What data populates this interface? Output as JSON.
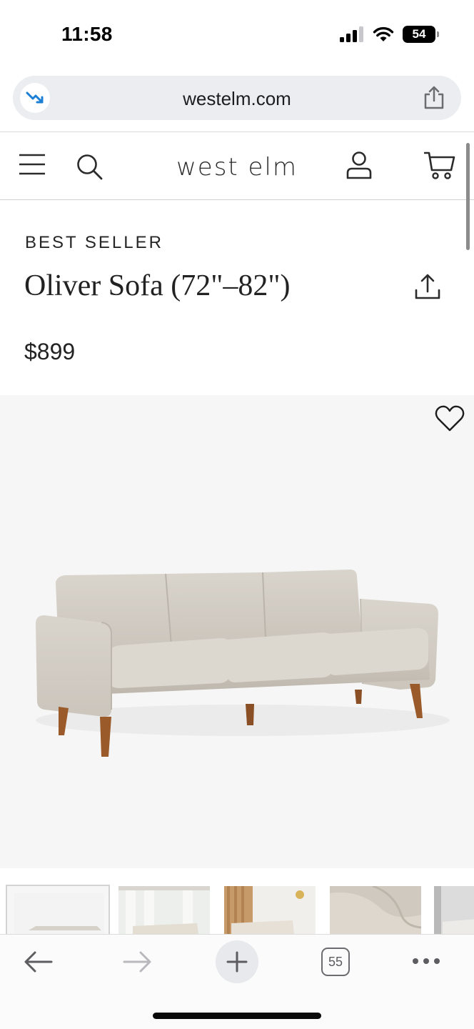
{
  "status_bar": {
    "time": "11:58",
    "battery_level": "54",
    "icons": [
      "cellular-signal-icon",
      "wifi-icon",
      "battery-icon"
    ]
  },
  "browser": {
    "url": "westelm.com",
    "open_tabs": "55",
    "icons": [
      "tracking-protection-icon",
      "share-icon",
      "back-arrow-icon",
      "forward-arrow-icon",
      "new-tab-icon",
      "tabs-icon",
      "more-icon"
    ]
  },
  "site": {
    "logo": "west elm",
    "icons": [
      "menu-icon",
      "search-icon",
      "account-icon",
      "cart-icon"
    ]
  },
  "product": {
    "badge": "BEST SELLER",
    "title": "Oliver Sofa (72\"–82\")",
    "price": "$899",
    "icons": [
      "share-icon",
      "heart-icon"
    ],
    "thumbnail_count": 5
  },
  "colors": {
    "accent_link": "#1b7fd6",
    "text": "#222222",
    "image_bg": "#f6f6f6",
    "sofa_fabric": "#d4cfc7",
    "sofa_legs": "#9a5a2a"
  }
}
